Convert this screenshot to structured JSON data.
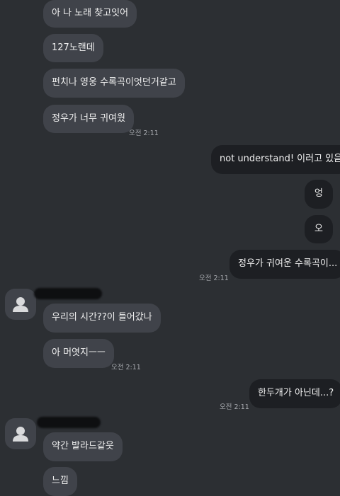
{
  "messages": [
    {
      "text": "아 나 노래 찾고잇어"
    },
    {
      "text": "127노랜데"
    },
    {
      "text": "펀치나 영웅 수록곡이엇던거같고"
    },
    {
      "text": "정우가 너무 귀여웠"
    },
    {
      "text": "not understand! 이러고 있음"
    },
    {
      "text": "엉"
    },
    {
      "text": "오"
    },
    {
      "text": "정우가 귀여운 수록곡이..."
    },
    {
      "text": "우리의 시간??이 들어갔나"
    },
    {
      "text": "아 머엿지ㅡㅡ"
    },
    {
      "text": "한두개가 아닌데...?"
    },
    {
      "text": "약간 발라드같읏"
    },
    {
      "text": "느낌"
    }
  ],
  "timestamps": {
    "t1": "오전 2:11",
    "t2": "오전 2:11",
    "t3": "오전 2:11",
    "t4": "오전 2:11",
    "t5": "오전 2:11"
  },
  "colors": {
    "background": "#2c2f33",
    "incoming_bubble": "#40434a",
    "outgoing_bubble": "#1d1f23"
  }
}
